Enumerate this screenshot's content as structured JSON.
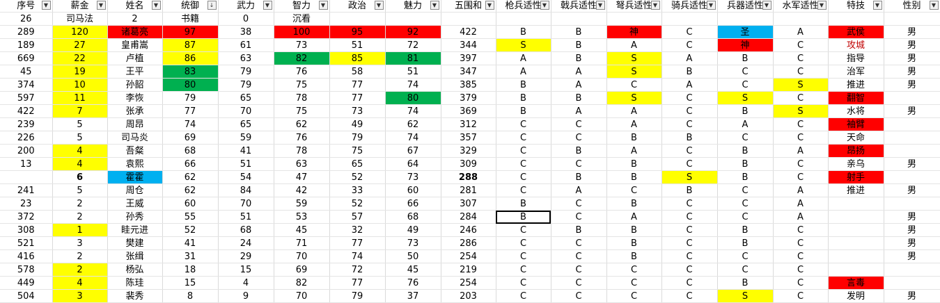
{
  "colors": {
    "yellow": "#ffff00",
    "red": "#ff0000",
    "green": "#00b050",
    "blue": "#00b0f0",
    "darkred": "#c00000"
  },
  "filter_icon": "dropdown-arrow-icon",
  "sort_icon": "sort-filter-icon",
  "headers": [
    "序号",
    "薪金",
    "姓名",
    "统御",
    "武力",
    "智力",
    "政治",
    "魅力",
    "五围和",
    "枪兵适性",
    "戟兵适性",
    "弩兵适性",
    "骑兵适性",
    "兵器适性",
    "水军适性",
    "特技",
    "性别"
  ],
  "rows": [
    {
      "c": [
        "26",
        "司马法",
        "2",
        "书籍",
        "0",
        "沉看",
        "",
        "",
        "",
        "",
        "",
        "",
        "",
        "",
        "",
        "",
        ""
      ]
    },
    {
      "c": [
        "289",
        "120",
        "诸葛亮",
        "97",
        "38",
        "100",
        "95",
        "92",
        "422",
        "B",
        "B",
        "神",
        "C",
        "圣",
        "A",
        "武侯",
        "男"
      ],
      "f": {
        "1": "yellow",
        "2": "red",
        "3": "red",
        "5": "red",
        "6": "red",
        "7": "red",
        "11": "red",
        "13": "blue",
        "15": "red"
      }
    },
    {
      "c": [
        "189",
        "27",
        "皇甫嵩",
        "87",
        "61",
        "73",
        "51",
        "72",
        "344",
        "S",
        "B",
        "A",
        "C",
        "神",
        "C",
        "攻城",
        "男"
      ],
      "f": {
        "1": "yellow",
        "3": "yellow",
        "9": "yellow",
        "13": "red"
      },
      "t": {
        "15": "darkred"
      }
    },
    {
      "c": [
        "669",
        "22",
        "卢植",
        "86",
        "63",
        "82",
        "85",
        "81",
        "397",
        "A",
        "B",
        "S",
        "A",
        "B",
        "C",
        "指导",
        "男"
      ],
      "f": {
        "1": "yellow",
        "3": "yellow",
        "5": "green",
        "6": "yellow",
        "7": "green",
        "11": "yellow"
      }
    },
    {
      "c": [
        "45",
        "19",
        "王平",
        "83",
        "79",
        "76",
        "58",
        "51",
        "347",
        "A",
        "A",
        "S",
        "B",
        "C",
        "C",
        "治军",
        "男"
      ],
      "f": {
        "1": "yellow",
        "3": "green",
        "11": "yellow"
      }
    },
    {
      "c": [
        "374",
        "10",
        "孙韶",
        "80",
        "79",
        "75",
        "77",
        "74",
        "385",
        "B",
        "A",
        "C",
        "A",
        "C",
        "S",
        "推进",
        "男"
      ],
      "f": {
        "1": "yellow",
        "3": "green",
        "14": "yellow"
      }
    },
    {
      "c": [
        "597",
        "11",
        "李恢",
        "79",
        "65",
        "78",
        "77",
        "80",
        "379",
        "B",
        "B",
        "S",
        "C",
        "S",
        "C",
        "翻智",
        ""
      ],
      "f": {
        "1": "yellow",
        "7": "green",
        "11": "yellow",
        "13": "yellow",
        "15": "red"
      }
    },
    {
      "c": [
        "422",
        "7",
        "张承",
        "77",
        "70",
        "75",
        "73",
        "74",
        "369",
        "B",
        "A",
        "A",
        "C",
        "B",
        "S",
        "水将",
        "男"
      ],
      "f": {
        "1": "yellow",
        "14": "yellow"
      }
    },
    {
      "c": [
        "239",
        "5",
        "周昂",
        "74",
        "65",
        "62",
        "49",
        "62",
        "312",
        "C",
        "C",
        "A",
        "C",
        "A",
        "C",
        "袖臂",
        ""
      ],
      "f": {
        "15": "red"
      }
    },
    {
      "c": [
        "226",
        "5",
        "司马炎",
        "69",
        "59",
        "76",
        "79",
        "74",
        "357",
        "C",
        "C",
        "B",
        "B",
        "C",
        "C",
        "天命",
        ""
      ]
    },
    {
      "c": [
        "200",
        "4",
        "吾粲",
        "68",
        "41",
        "78",
        "75",
        "67",
        "329",
        "C",
        "B",
        "A",
        "C",
        "B",
        "A",
        "昂扬",
        ""
      ],
      "f": {
        "1": "yellow",
        "15": "red"
      }
    },
    {
      "c": [
        "13",
        "4",
        "袁熙",
        "66",
        "51",
        "63",
        "65",
        "64",
        "309",
        "C",
        "C",
        "B",
        "C",
        "B",
        "C",
        "亲乌",
        "男"
      ],
      "f": {
        "1": "yellow"
      }
    },
    {
      "c": [
        "",
        "6",
        "霍霍",
        "62",
        "54",
        "47",
        "52",
        "73",
        "288",
        "C",
        "B",
        "B",
        "S",
        "B",
        "C",
        "射手",
        ""
      ],
      "f": {
        "2": "blue",
        "12": "yellow",
        "15": "red"
      },
      "b": [
        1,
        8
      ]
    },
    {
      "c": [
        "241",
        "5",
        "周仓",
        "62",
        "84",
        "42",
        "33",
        "60",
        "281",
        "C",
        "A",
        "C",
        "B",
        "C",
        "A",
        "推进",
        "男"
      ]
    },
    {
      "c": [
        "23",
        "2",
        "王威",
        "60",
        "70",
        "59",
        "52",
        "66",
        "307",
        "B",
        "C",
        "B",
        "C",
        "C",
        "A",
        "",
        ""
      ]
    },
    {
      "c": [
        "372",
        "2",
        "孙秀",
        "55",
        "51",
        "53",
        "57",
        "68",
        "284",
        "B",
        "C",
        "A",
        "C",
        "C",
        "A",
        "",
        "男"
      ],
      "s": 9
    },
    {
      "c": [
        "308",
        "1",
        "眭元进",
        "52",
        "68",
        "45",
        "32",
        "49",
        "246",
        "C",
        "B",
        "B",
        "C",
        "B",
        "C",
        "",
        "男"
      ],
      "f": {
        "1": "yellow"
      }
    },
    {
      "c": [
        "521",
        "3",
        "樊建",
        "41",
        "24",
        "71",
        "77",
        "73",
        "286",
        "C",
        "C",
        "B",
        "C",
        "B",
        "C",
        "",
        "男"
      ]
    },
    {
      "c": [
        "416",
        "2",
        "张缉",
        "31",
        "29",
        "70",
        "74",
        "50",
        "254",
        "C",
        "C",
        "B",
        "C",
        "C",
        "C",
        "",
        "男"
      ]
    },
    {
      "c": [
        "578",
        "2",
        "杨弘",
        "18",
        "15",
        "69",
        "72",
        "45",
        "219",
        "C",
        "C",
        "C",
        "C",
        "C",
        "C",
        "",
        ""
      ],
      "f": {
        "1": "yellow"
      }
    },
    {
      "c": [
        "449",
        "4",
        "陈珪",
        "15",
        "4",
        "82",
        "77",
        "76",
        "254",
        "C",
        "C",
        "C",
        "C",
        "B",
        "C",
        "言毒",
        ""
      ],
      "f": {
        "1": "yellow",
        "15": "red"
      }
    },
    {
      "c": [
        "504",
        "3",
        "裴秀",
        "8",
        "9",
        "70",
        "79",
        "37",
        "203",
        "C",
        "C",
        "C",
        "C",
        "S",
        "C",
        "发明",
        "男"
      ],
      "f": {
        "1": "yellow",
        "13": "yellow"
      }
    }
  ]
}
